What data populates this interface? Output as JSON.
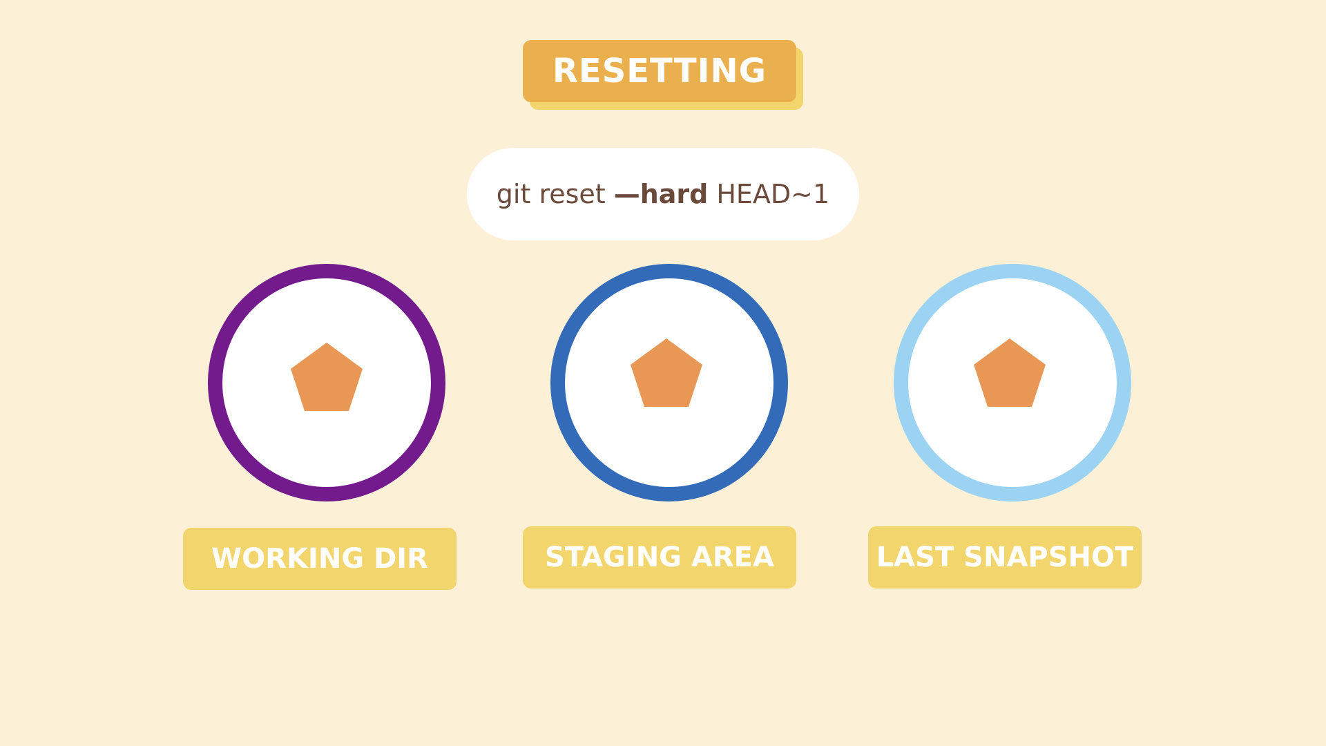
{
  "title": "RESETTING",
  "command": {
    "prefix": "git reset",
    "flag": "—hard",
    "suffix": "HEAD~1"
  },
  "areas": [
    {
      "label": "WORKING DIR",
      "ring_color": "#731A8C",
      "icon": "pentagon-file-icon"
    },
    {
      "label": "STAGING AREA",
      "ring_color": "#336BB9",
      "icon": "pentagon-file-icon"
    },
    {
      "label": "LAST SNAPSHOT",
      "ring_color": "#9CD3F3",
      "icon": "pentagon-file-icon"
    }
  ],
  "colors": {
    "background": "#FCF1D7",
    "title_badge": "#EBB04E",
    "label_badge": "#F3D56E",
    "file_shape": "#E89754",
    "command_text": "#6B4A3C"
  }
}
